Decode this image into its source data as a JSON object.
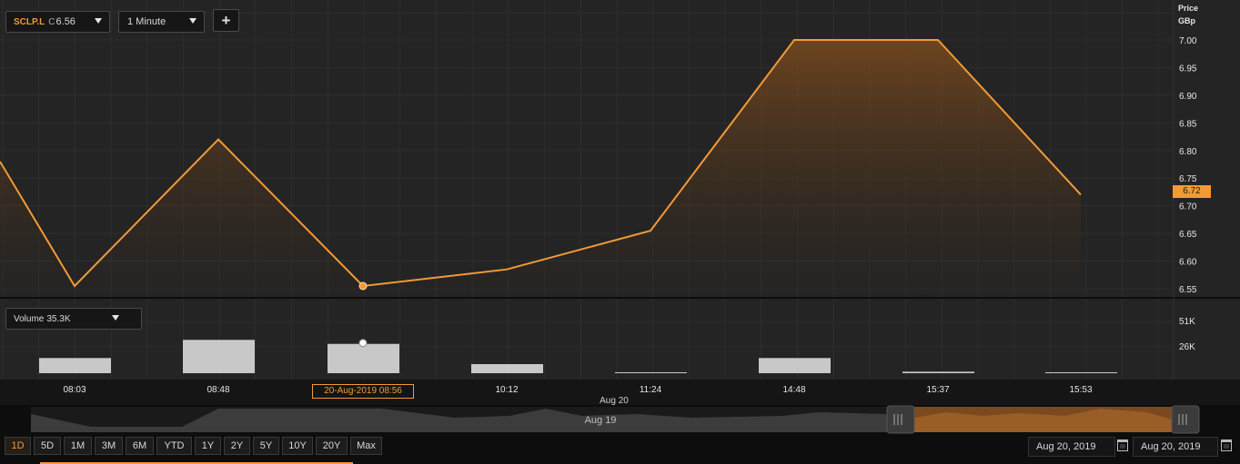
{
  "toolbar": {
    "symbol": "SCLP.L",
    "close_label": "C",
    "close_value": "6.56",
    "interval": "1 Minute",
    "add_label": "+"
  },
  "volume_selector": {
    "label": "Volume",
    "value": "35.3K"
  },
  "price_axis": {
    "title": "Price",
    "unit": "GBp",
    "current_price": "6.72"
  },
  "hover": {
    "timestamp": "20-Aug-2019 08:56"
  },
  "navigator": {
    "label": "Aug 19"
  },
  "range_buttons": [
    "1D",
    "5D",
    "1M",
    "3M",
    "6M",
    "YTD",
    "1Y",
    "2Y",
    "5Y",
    "10Y",
    "20Y",
    "Max"
  ],
  "active_range": "1D",
  "date_from": "Aug 20, 2019",
  "date_to": "Aug 20, 2019",
  "colors": {
    "accent": "#f29a36",
    "background": "#242424",
    "grid": "#3a3a3a",
    "volume_bar": "#c8c8c8"
  },
  "chart_data": {
    "type": "line",
    "x": [
      "08:03",
      "08:48",
      "08:56",
      "10:12",
      "11:24",
      "14:48",
      "15:37",
      "15:53"
    ],
    "series": [
      {
        "name": "SCLP.L",
        "values": [
          6.555,
          6.82,
          6.555,
          6.585,
          6.655,
          7.0,
          7.0,
          6.72
        ]
      }
    ],
    "leading_value": 6.78,
    "x_tick_labels": [
      "08:03",
      "08:48",
      "10:12",
      "11:24",
      "14:48",
      "15:37",
      "15:53"
    ],
    "x_sublabel": "Aug 20",
    "ylabel": "Price GBp",
    "ylim": [
      6.53,
      7.04
    ],
    "y_ticks": [
      "6.55",
      "6.60",
      "6.65",
      "6.70",
      "6.75",
      "6.80",
      "6.85",
      "6.90",
      "6.95",
      "7.00"
    ],
    "volume": {
      "values": [
        15000,
        33000,
        29000,
        9000,
        800,
        15000,
        1500,
        800
      ],
      "ylim": [
        0,
        62000
      ],
      "y_ticks": [
        "26K",
        "51K"
      ]
    },
    "highlight_index": 2,
    "grid": true
  }
}
